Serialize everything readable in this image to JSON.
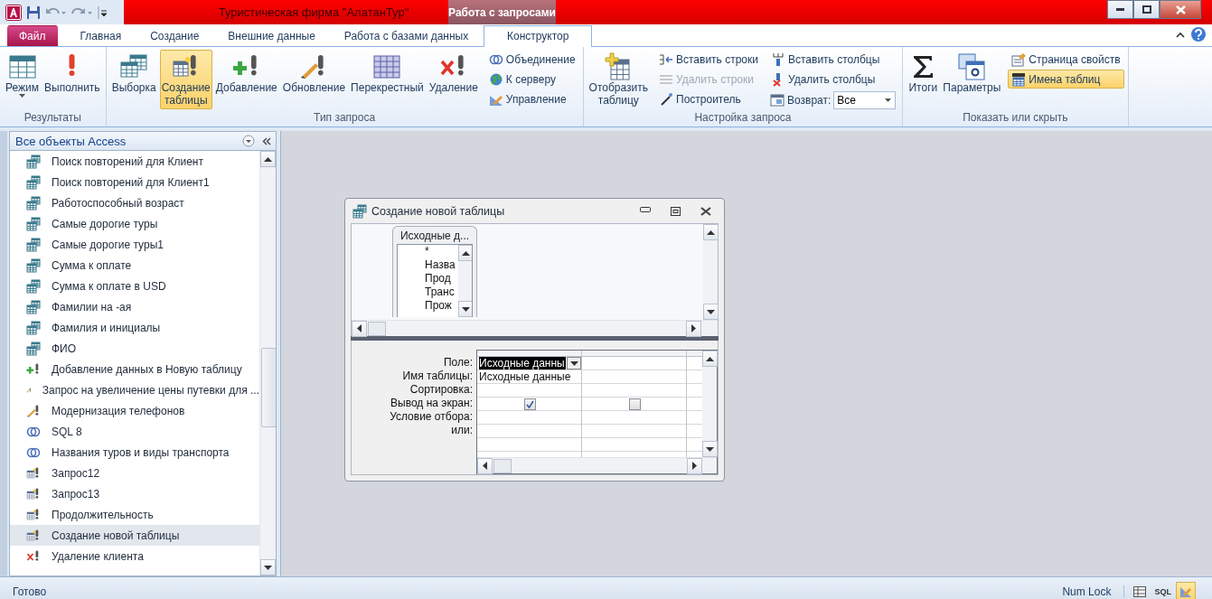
{
  "title_bar": {
    "title": "Туристическая фирма \"АлатанТур\"",
    "context_tab": "Работа с запросами"
  },
  "tabs": [
    {
      "label": "Файл",
      "kind": "file",
      "selected": false
    },
    {
      "label": "Главная",
      "kind": "tab",
      "selected": false
    },
    {
      "label": "Создание",
      "kind": "tab",
      "selected": false
    },
    {
      "label": "Внешние данные",
      "kind": "tab",
      "selected": false
    },
    {
      "label": "Работа с базами данных",
      "kind": "tab",
      "selected": false
    },
    {
      "label": "Конструктор",
      "kind": "tab",
      "selected": true
    }
  ],
  "ribbon_groups": [
    {
      "title": "Результаты",
      "items": [
        {
          "kind": "large",
          "label": "Режим",
          "menu": true
        },
        {
          "kind": "large",
          "label": "Выполнить"
        }
      ]
    },
    {
      "title": "Тип запроса",
      "items": [
        {
          "kind": "large",
          "label": "Выборка",
          "selected": false
        },
        {
          "kind": "large",
          "label": "Создание таблицы",
          "selected": true
        },
        {
          "kind": "large",
          "label": "Добавление",
          "selected": false
        },
        {
          "kind": "large",
          "label": "Обновление",
          "selected": false
        },
        {
          "kind": "large",
          "label": "Перекрестный",
          "selected": false
        },
        {
          "kind": "large",
          "label": "Удаление",
          "selected": false
        },
        {
          "kind": "stack",
          "items": [
            {
              "kind": "small",
              "label": "Объединение",
              "selected": false
            },
            {
              "kind": "small",
              "label": "К серверу",
              "selected": false
            },
            {
              "kind": "small",
              "label": "Управление",
              "selected": false
            }
          ]
        }
      ]
    },
    {
      "title": "Настройка запроса",
      "items": [
        {
          "kind": "large",
          "label": "Отобразить таблицу"
        },
        {
          "kind": "stack",
          "items": [
            {
              "kind": "small",
              "label": "Вставить строки",
              "disabled": false
            },
            {
              "kind": "small",
              "label": "Удалить строки",
              "disabled": true
            },
            {
              "kind": "small",
              "label": "Построитель",
              "disabled": false
            }
          ]
        },
        {
          "kind": "stack",
          "items": [
            {
              "kind": "small",
              "label": "Вставить столбцы",
              "disabled": false
            },
            {
              "kind": "small",
              "label": "Удалить столбцы",
              "disabled": false
            },
            {
              "kind": "combo",
              "label": "Возврат:",
              "value": "Все"
            }
          ]
        }
      ]
    },
    {
      "title": "Показать или скрыть",
      "items": [
        {
          "kind": "large",
          "label": "Итоги",
          "on": false
        },
        {
          "kind": "large",
          "label": "Параметры"
        },
        {
          "kind": "stack",
          "items": [
            {
              "kind": "small",
              "label": "Страница свойств",
              "on": false
            },
            {
              "kind": "small",
              "label": "Имена таблиц",
              "on": true
            }
          ]
        }
      ]
    }
  ],
  "nav_pane": {
    "title": "Все объекты Access",
    "items": [
      {
        "label": "Поиск повторений для Клиент",
        "kind": "select",
        "selected": false
      },
      {
        "label": "Поиск повторений для Клиент1",
        "kind": "select",
        "selected": false
      },
      {
        "label": "Работоспособный возраст",
        "kind": "select",
        "selected": false
      },
      {
        "label": "Самые дорогие туры",
        "kind": "select",
        "selected": false
      },
      {
        "label": "Самые дорогие туры1",
        "kind": "select",
        "selected": false
      },
      {
        "label": "Сумма к оплате",
        "kind": "select",
        "selected": false
      },
      {
        "label": "Сумма к оплате в USD",
        "kind": "select",
        "selected": false
      },
      {
        "label": "Фамилии на -ая",
        "kind": "select",
        "selected": false
      },
      {
        "label": "Фамилия и инициалы",
        "kind": "select",
        "selected": false
      },
      {
        "label": "ФИО",
        "kind": "select",
        "selected": false
      },
      {
        "label": "Добавление данных в Новую таблицу",
        "kind": "append",
        "selected": false
      },
      {
        "label": "Запрос на увеличение цены путевки для ...",
        "kind": "update",
        "selected": false
      },
      {
        "label": "Модернизация телефонов",
        "kind": "update",
        "selected": false
      },
      {
        "label": "SQL 8",
        "kind": "union",
        "selected": false
      },
      {
        "label": "Названия туров и виды транспорта",
        "kind": "union",
        "selected": false
      },
      {
        "label": "Запрос12",
        "kind": "make_table",
        "selected": false
      },
      {
        "label": "Запрос13",
        "kind": "make_table",
        "selected": false
      },
      {
        "label": "Продолжительность",
        "kind": "make_table",
        "selected": false
      },
      {
        "label": "Создание новой таблицы",
        "kind": "make_table",
        "selected": true
      },
      {
        "label": "Удаление клиента",
        "kind": "delete",
        "selected": false
      }
    ]
  },
  "query_window": {
    "title": "Создание новой таблицы",
    "table": {
      "title": "Исходные д...",
      "fields": [
        "*",
        "Назва",
        "Прод",
        "Транс",
        "Прож"
      ]
    },
    "row_labels": [
      "Поле:",
      "Имя таблицы:",
      "Сортировка:",
      "Вывод на экран:",
      "Условие отбора:",
      "или:"
    ],
    "columns": [
      {
        "field": "Исходные данны",
        "table": "Исходные данные",
        "show": true,
        "selected": true
      },
      {
        "show": false,
        "selected": false
      }
    ]
  },
  "status_bar": {
    "text": "Готово",
    "indicators": [
      "Num Lock"
    ],
    "views": [
      {
        "kind": "datasheet",
        "selected": false
      },
      {
        "kind": "sql",
        "label": "SQL",
        "selected": false
      },
      {
        "kind": "design",
        "selected": true
      }
    ]
  }
}
